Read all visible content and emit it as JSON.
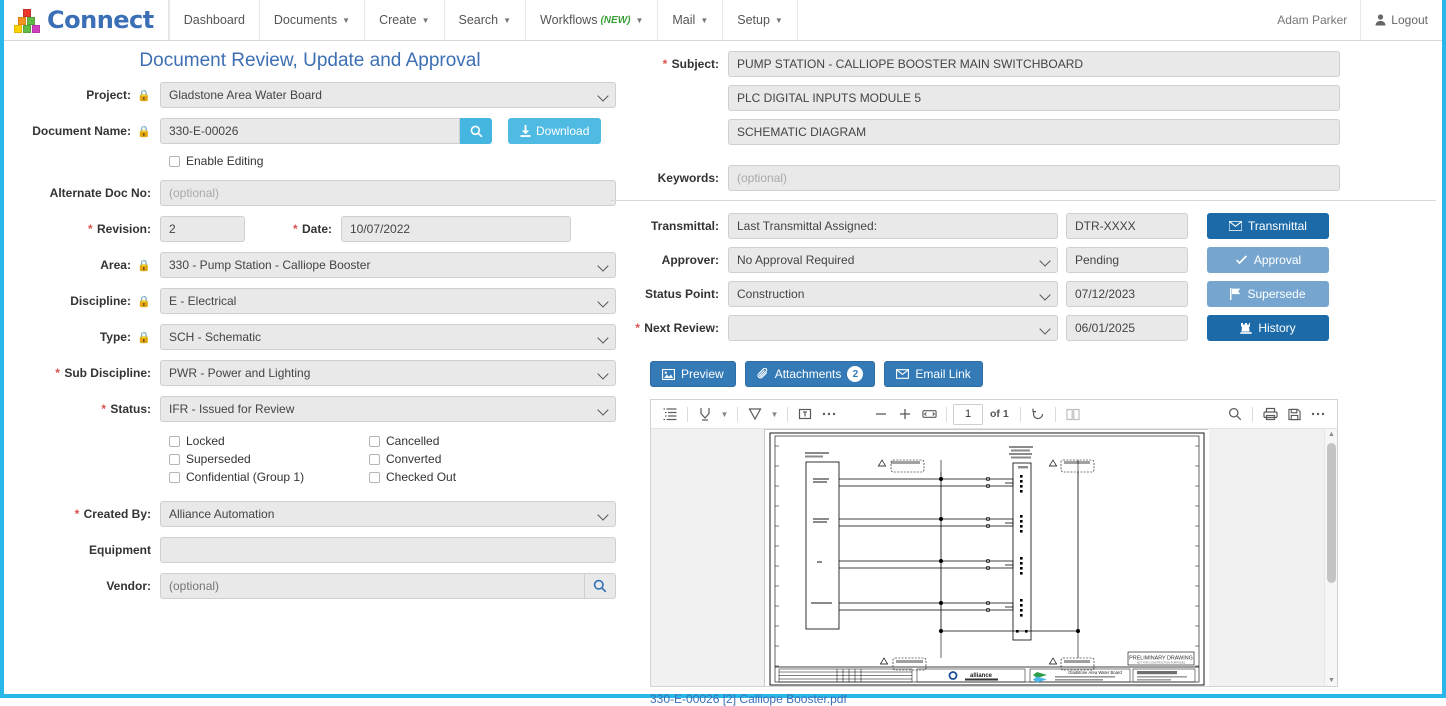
{
  "navbar": {
    "brand": "Connect",
    "items": [
      {
        "label": "Dashboard",
        "caret": false,
        "new": false
      },
      {
        "label": "Documents",
        "caret": true,
        "new": false
      },
      {
        "label": "Create",
        "caret": true,
        "new": false
      },
      {
        "label": "Search",
        "caret": true,
        "new": false
      },
      {
        "label": "Workflows",
        "caret": true,
        "new": true,
        "new_label": "(NEW)"
      },
      {
        "label": "Mail",
        "caret": true,
        "new": false
      },
      {
        "label": "Setup",
        "caret": true,
        "new": false
      }
    ],
    "user": "Adam Parker",
    "logout": "Logout"
  },
  "page_title": "Document Review, Update and Approval",
  "left_form": {
    "project": {
      "label": "Project:",
      "locked": true,
      "required": false,
      "value": "Gladstone Area Water Board"
    },
    "document_name": {
      "label": "Document Name:",
      "locked": true,
      "value": "330-E-00026",
      "download_label": "Download"
    },
    "enable_editing": {
      "label": "Enable Editing",
      "checked": false
    },
    "alternate_doc_no": {
      "label": "Alternate Doc No:",
      "placeholder": "(optional)",
      "value": ""
    },
    "revision": {
      "label": "Revision:",
      "required": true,
      "value": "2"
    },
    "date": {
      "label": "Date:",
      "required": true,
      "value": "10/07/2022"
    },
    "area": {
      "label": "Area:",
      "locked": true,
      "value": "330 - Pump Station - Calliope Booster"
    },
    "discipline": {
      "label": "Discipline:",
      "locked": true,
      "value": "E - Electrical"
    },
    "type": {
      "label": "Type:",
      "locked": true,
      "value": "SCH - Schematic"
    },
    "sub_discipline": {
      "label": "Sub Discipline:",
      "required": true,
      "value": "PWR - Power and Lighting"
    },
    "status": {
      "label": "Status:",
      "required": true,
      "value": "IFR - Issued for Review"
    },
    "flags_col1": [
      {
        "label": "Locked",
        "checked": false
      },
      {
        "label": "Superseded",
        "checked": false
      },
      {
        "label": "Confidential (Group 1)",
        "checked": false
      }
    ],
    "flags_col2": [
      {
        "label": "Cancelled",
        "checked": false
      },
      {
        "label": "Converted",
        "checked": false
      },
      {
        "label": "Checked Out",
        "checked": false
      }
    ],
    "created_by": {
      "label": "Created By:",
      "required": true,
      "value": "Alliance Automation"
    },
    "equipment": {
      "label": "Equipment",
      "value": ""
    },
    "vendor": {
      "label": "Vendor:",
      "placeholder": "(optional)",
      "value": ""
    }
  },
  "right_form": {
    "subject": {
      "label": "Subject:",
      "required": true,
      "line1": "PUMP STATION - CALLIOPE BOOSTER MAIN SWITCHBOARD",
      "line2": "PLC DIGITAL INPUTS MODULE 5",
      "line3": "SCHEMATIC DIAGRAM"
    },
    "keywords": {
      "label": "Keywords:",
      "placeholder": "(optional)",
      "value": ""
    },
    "transmittal": {
      "label": "Transmittal:",
      "value": "Last Transmittal Assigned:",
      "code": "DTR-XXXX",
      "button": "Transmittal"
    },
    "approver": {
      "label": "Approver:",
      "value": "No Approval Required",
      "state": "Pending",
      "button": "Approval"
    },
    "status_point": {
      "label": "Status Point:",
      "value": "Construction",
      "date": "07/12/2023",
      "button": "Supersede"
    },
    "next_review": {
      "label": "Next Review:",
      "required": true,
      "value": "",
      "date": "06/01/2025",
      "button": "History"
    }
  },
  "actions": {
    "preview": "Preview",
    "attachments": "Attachments",
    "attachments_count": "2",
    "email_link": "Email Link"
  },
  "pdf_viewer": {
    "page_current": "1",
    "page_total_label": "of 1",
    "file_name": "330-E-00026 [2] Calliope Booster.pdf"
  },
  "colors": {
    "frame_blue": "#29b6e8",
    "title_blue": "#3d6fb4",
    "primary_blue": "#337ab7",
    "dark_blue": "#1c6ba8",
    "light_blue": "#76a6cf",
    "cyan": "#4fbbe3",
    "required_red": "#d9534f",
    "lock_red": "#d9342b"
  }
}
